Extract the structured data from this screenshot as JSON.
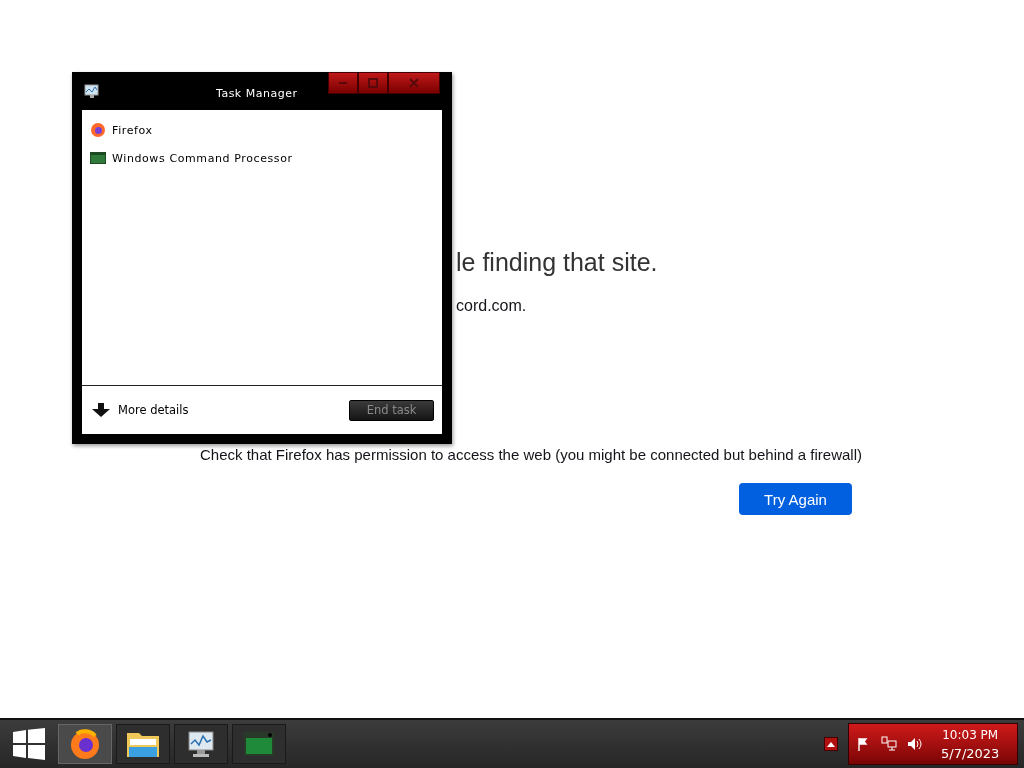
{
  "browser_page": {
    "heading": "le finding that site.",
    "domain_text": "cord.com.",
    "hint": "Check that Firefox has permission to access the web (you might be connected but behind a firewall)",
    "button": "Try Again"
  },
  "task_manager": {
    "title": "Task Manager",
    "apps": [
      {
        "name": "Firefox",
        "kind": "firefox"
      },
      {
        "name": "Windows Command Processor",
        "kind": "console"
      }
    ],
    "more_details": "More details",
    "end_task": {
      "label": "End task",
      "disabled": true
    }
  },
  "taskbar": {
    "apps": [
      {
        "kind": "firefox",
        "selected": true
      },
      {
        "kind": "folder",
        "selected": false
      },
      {
        "kind": "monitor",
        "selected": false
      },
      {
        "kind": "console",
        "selected": false
      }
    ],
    "time": "10:03 PM",
    "date": "5/7/2023"
  }
}
